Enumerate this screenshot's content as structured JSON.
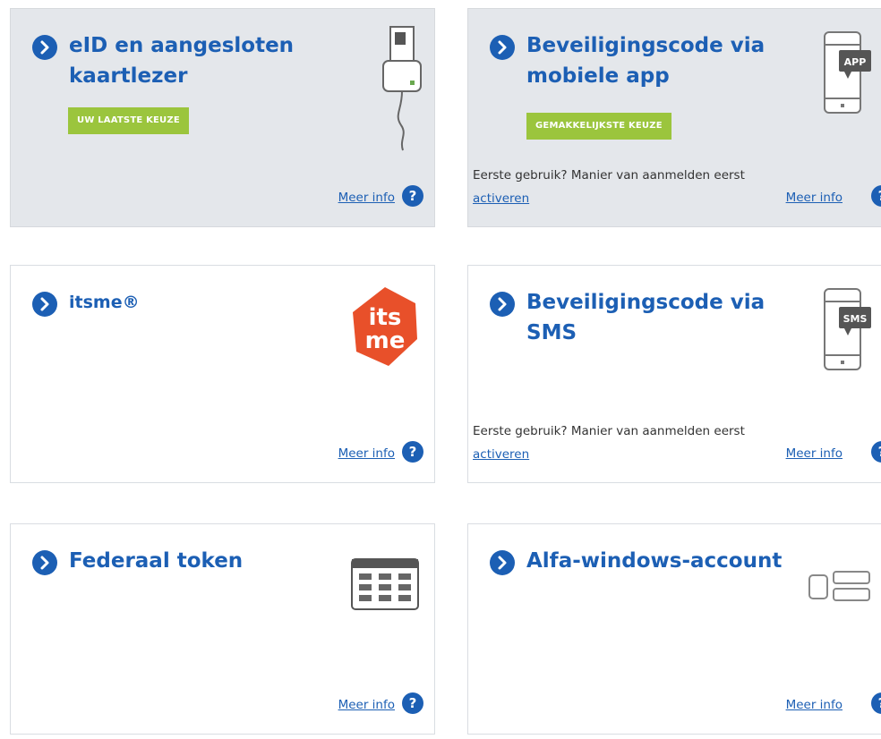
{
  "colors": {
    "primary": "#1c5fb4",
    "badge": "#9bc53d",
    "selected_bg": "#e4e7eb",
    "itsme": "#e8502a"
  },
  "cards": [
    {
      "title": "eID en aangesloten kaartlezer",
      "badge": "UW LAATSTE KEUZE",
      "more_info": "Meer info",
      "help": "?",
      "icon": "card-reader-icon",
      "selected": true
    },
    {
      "title": "Beveiligingscode via mobiele app",
      "badge": "GEMAKKELIJKSTE KEUZE",
      "first_use": "Eerste gebruik? Manier van aanmelden eerst",
      "activate": "activeren",
      "more_info": "Meer info",
      "help": "?",
      "icon": "mobile-app-icon",
      "icon_label": "APP",
      "selected": true
    },
    {
      "title": "itsme®",
      "more_info": "Meer info",
      "help": "?",
      "icon": "itsme-logo",
      "logo_top": "its",
      "logo_bottom": "me"
    },
    {
      "title": "Beveiligingscode via SMS",
      "first_use": "Eerste gebruik? Manier van aanmelden eerst",
      "activate": "activeren",
      "more_info": "Meer info",
      "help": "?",
      "icon": "sms-phone-icon",
      "icon_label": "SMS"
    },
    {
      "title": "Federaal token",
      "more_info": "Meer info",
      "help": "?",
      "icon": "token-grid-icon"
    },
    {
      "title": "Alfa-windows-account",
      "more_info": "Meer info",
      "help": "?",
      "icon": "account-icon"
    }
  ]
}
